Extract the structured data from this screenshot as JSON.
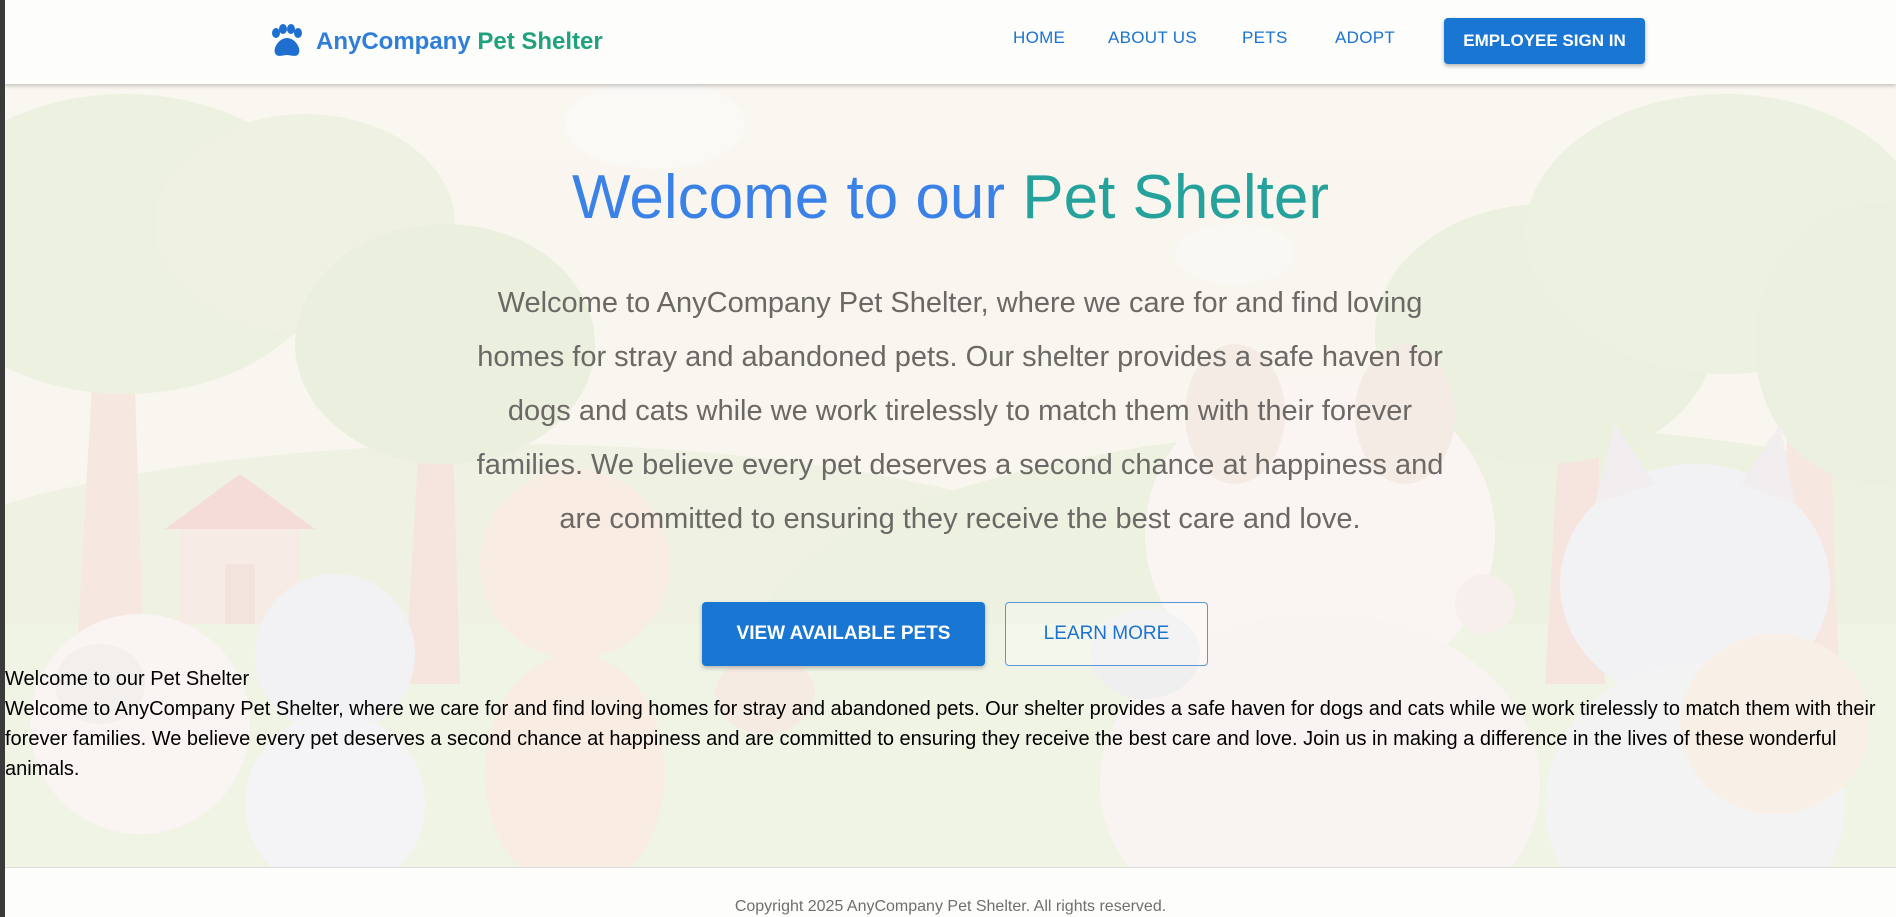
{
  "header": {
    "brand": {
      "part1": "AnyCompany",
      "part2": "Pet Shelter",
      "icon": "paw-icon"
    },
    "nav": [
      {
        "label": "HOME"
      },
      {
        "label": "ABOUT US"
      },
      {
        "label": "PETS"
      },
      {
        "label": "ADOPT"
      }
    ],
    "signin_label": "EMPLOYEE SIGN IN"
  },
  "hero": {
    "title_part1": "Welcome to our",
    "title_part2": "Pet Shelter",
    "description": "Welcome to AnyCompany Pet Shelter, where we care for and find loving homes for stray and abandoned pets. Our shelter provides a safe haven for dogs and cats while we work tirelessly to match them with their forever families. We believe every pet deserves a second chance at happiness and are committed to ensuring they receive the best care and love.",
    "primary_button": "VIEW AVAILABLE PETS",
    "secondary_button": "LEARN MORE"
  },
  "unstyled": {
    "heading": "Welcome to our Pet Shelter",
    "body": "Welcome to AnyCompany Pet Shelter, where we care for and find loving homes for stray and abandoned pets. Our shelter provides a safe haven for dogs and cats while we work tirelessly to match them with their forever families. We believe every pet deserves a second chance at happiness and are committed to ensuring they receive the best care and love. Join us in making a difference in the lives of these wonderful animals."
  },
  "footer": {
    "copyright": "Copyright 2025 AnyCompany Pet Shelter. All rights reserved."
  },
  "colors": {
    "primary": "#1976d2",
    "brand_blue": "#2f7ed8",
    "brand_green": "#1fa37e",
    "title_teal": "#26a29c"
  }
}
